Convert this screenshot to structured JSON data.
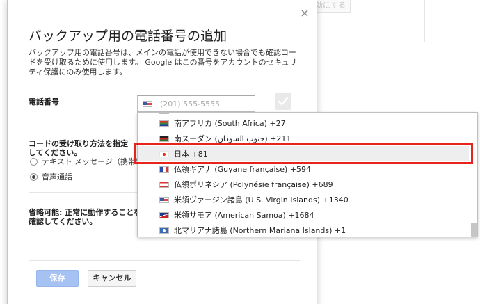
{
  "background": {
    "button_label": "効にする"
  },
  "dialog": {
    "title": "バックアップ用の電話番号の追加",
    "description": "バックアップ用の電話番号は、メインの電話が使用できない場合でも確認コードを受け取るために使用します。 Google はこの番号をアカウントのセキュリティ保護にのみ使用します。",
    "close_icon": "×",
    "phone_label": "電話番号",
    "phone_placeholder": "(201) 555-5555",
    "method_label": "コードの受け取り方法を指定してください。",
    "method_options": [
      {
        "label": "テキスト メッセージ（携帯電話",
        "checked": false
      },
      {
        "label": "音声通話",
        "checked": true
      }
    ],
    "optional_label": "省略可能: 正常に動作することを確認してください。",
    "save_label": "保存",
    "cancel_label": "キャンセル"
  },
  "dropdown": {
    "items": [
      {
        "flag": "za-flag-icon",
        "label": "南アフリカ (South Africa) +27"
      },
      {
        "flag": "ss-flag-icon",
        "label": "南スーダン (جنوب السودان) +211"
      },
      {
        "flag": "jp-flag-icon",
        "label": "日本 +81",
        "highlighted": true
      },
      {
        "flag": "gf-flag-icon",
        "label": "仏領ギアナ (Guyane française) +594"
      },
      {
        "flag": "pf-flag-icon",
        "label": "仏領ポリネシア (Polynésie française) +689"
      },
      {
        "flag": "vi-flag-icon",
        "label": "米領ヴァージン諸島 (U.S. Virgin Islands) +1340"
      },
      {
        "flag": "as-flag-icon",
        "label": "米領サモア (American Samoa) +1684"
      },
      {
        "flag": "mp-flag-icon",
        "label": "北マリアナ諸島 (Northern Mariana Islands) +1"
      }
    ]
  },
  "colors": {
    "highlight_border": "#e8231a",
    "save_button_bg": "#a5c2f3"
  }
}
